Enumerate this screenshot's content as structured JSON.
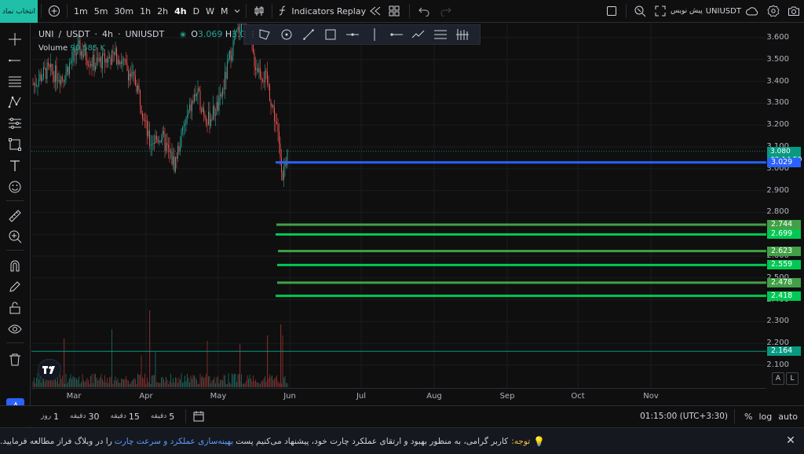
{
  "topbar": {
    "choose_btn": "انتخاب نماد",
    "timeframes": [
      "1m",
      "5m",
      "30m",
      "1h",
      "2h",
      "4h",
      "D",
      "W",
      "M"
    ],
    "active_tf": "4h",
    "indicators_label": "Indicators",
    "replay_label": "Replay",
    "symbol_search": "UNIUSDT",
    "symbol_search_prefix": "پیش نویس"
  },
  "legend": {
    "symbol": "UNI",
    "slash": "/",
    "quote": "USDT",
    "interval": "4h",
    "exchange_symbol": "UNIUSDT",
    "o_label": "O",
    "o_value": "3.069",
    "h_label": "H",
    "h_value": "3.080",
    "l_label": "L",
    "volume_label": "Volume",
    "volume_value": "90.585 K"
  },
  "price_axis": {
    "ticks": [
      "3.600",
      "3.500",
      "3.400",
      "3.300",
      "3.200",
      "3.100",
      "3.000",
      "2.900",
      "2.800",
      "2.700",
      "2.600",
      "2.500",
      "2.400",
      "2.300",
      "2.200",
      "2.100"
    ],
    "current_price": "3.080",
    "countdown": "02:14:59",
    "levels": [
      {
        "value": "3.029",
        "color": "#2962ff"
      },
      {
        "value": "2.744",
        "color": "#43a047"
      },
      {
        "value": "2.699",
        "color": "#00c853"
      },
      {
        "value": "2.623",
        "color": "#43a047"
      },
      {
        "value": "2.559",
        "color": "#00c853"
      },
      {
        "value": "2.478",
        "color": "#43a047"
      },
      {
        "value": "2.418",
        "color": "#00c853"
      },
      {
        "value": "2.164",
        "color": "#089981"
      }
    ]
  },
  "time_axis": {
    "ticks": [
      "Mar",
      "Apr",
      "May",
      "Jun",
      "Jul",
      "Aug",
      "Sep",
      "Oct",
      "Nov"
    ]
  },
  "axis_buttons": {
    "auto_scale": "A",
    "log_scale": "L"
  },
  "bottombar": {
    "ranges": [
      {
        "n": "5",
        "u": "دقیقه"
      },
      {
        "n": "15",
        "u": "دقیقه"
      },
      {
        "n": "30",
        "u": "دقیقه"
      },
      {
        "n": "1",
        "u": "روز"
      }
    ],
    "clock": "01:15:00 (UTC+3:30)",
    "percent": "%",
    "log": "log",
    "auto": "auto"
  },
  "notice": {
    "label": "توجه:",
    "text_before": "کاربر گرامی، به منظور بهبود و ارتقای عملکرد چارت خود، پیشنهاد می‌کنیم پست",
    "link": "بهینه‌سازی عملکرد و سرعت چارت",
    "text_after": "را در وبلاگ فراز مطالعه فرمایید."
  },
  "colors": {
    "up": "#26a69a",
    "down": "#ef5350",
    "background": "#0f0f0f",
    "accent": "#2962ff"
  }
}
